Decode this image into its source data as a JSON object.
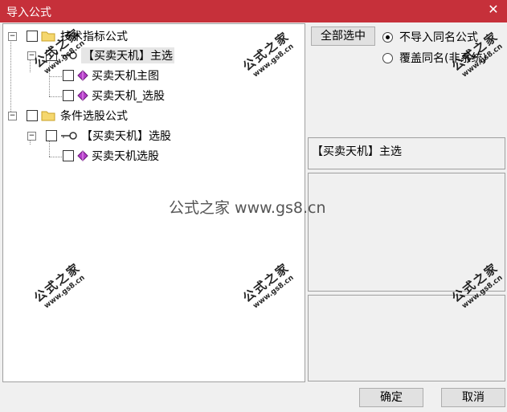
{
  "window": {
    "title": "导入公式",
    "close_glyph": "✕"
  },
  "tree": {
    "groups": [
      {
        "label": "技术指标公式",
        "expander": "−",
        "formula": {
          "label": "【买卖天机】主选",
          "expander": "−",
          "items": [
            "买卖天机主图",
            "买卖天机_选股"
          ]
        }
      },
      {
        "label": "条件选股公式",
        "expander": "−",
        "formula": {
          "label": "【买卖天机】选股",
          "expander": "−",
          "items": [
            "买卖天机选股"
          ]
        }
      }
    ]
  },
  "buttons": {
    "select_all": "全部选中",
    "ok": "确定",
    "cancel": "取消"
  },
  "options": {
    "no_import_same": "不导入同名公式",
    "overwrite_same": "覆盖同名(非系统)"
  },
  "selected_name": "【买卖天机】主选",
  "watermark": {
    "cn": "公式之家",
    "url": "www.gs8.cn",
    "center": "公式之家 www.gs8.cn"
  },
  "colors": {
    "titlebar": "#c6303a"
  }
}
